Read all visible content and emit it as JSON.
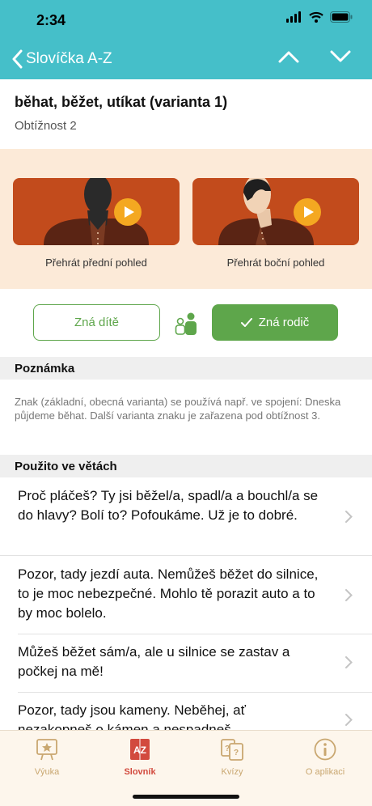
{
  "status": {
    "time": "2:34"
  },
  "nav": {
    "back_label": "Slovíčka A-Z"
  },
  "word": {
    "title": "běhat, běžet, utíkat (varianta 1)",
    "difficulty": "Obtížnost 2"
  },
  "videos": {
    "front_caption": "Přehrát přední pohled",
    "side_caption": "Přehrát boční pohled"
  },
  "knowledge": {
    "child_label": "Zná dítě",
    "parent_label": "Zná rodič"
  },
  "note": {
    "header": "Poznámka",
    "text": "Znak (základní, obecná  varianta) se používá např. ve spojení: Dneska půjdeme běhat. Další varianta znaku je zařazena pod obtížnost 3."
  },
  "sentences": {
    "header": "Použito ve větách",
    "items": [
      "Proč pláčeš? Ty jsi běžel/a, spadl/a a bouchl/a se do hlavy? Bolí to? Pofoukáme. Už je to dobré.",
      "Pozor, tady jezdí auta. Nemůžeš běžet do silnice, to je moc nebezpečné. Mohlo tě porazit auto a to by moc bolelo.",
      "Můžeš běžet sám/a, ale u silnice se zastav a počkej na mě!",
      "Pozor, tady jsou kameny. Neběhej, ať nezakopneš o kámen a nespadneš."
    ]
  },
  "tabs": {
    "learning": "Výuka",
    "dictionary": "Slovník",
    "quizzes": "Kvízy",
    "about": "O aplikaci",
    "dictionary_icon_text": "AZ"
  },
  "colors": {
    "header": "#45bfc9",
    "accent_green": "#5ea64b",
    "video_bg": "#c24b1c",
    "tab_active": "#d24a3e",
    "tab_inactive": "#c9a770"
  }
}
